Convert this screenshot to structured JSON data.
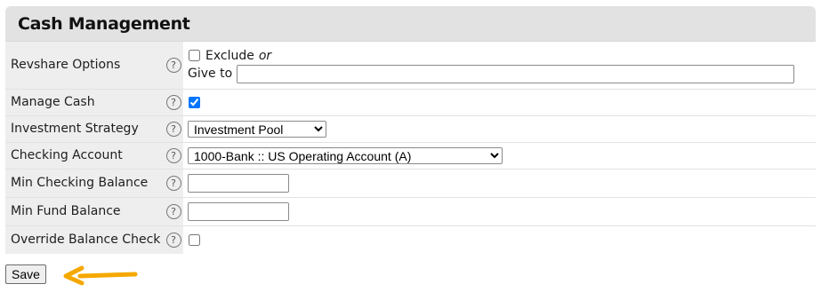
{
  "panel": {
    "title": "Cash Management"
  },
  "help_glyph": "?",
  "rows": {
    "revshare": {
      "label": "Revshare Options",
      "exclude_label": "Exclude",
      "or_text": "or",
      "give_to_label": "Give to",
      "exclude_checked": false,
      "give_to_value": ""
    },
    "manage_cash": {
      "label": "Manage Cash",
      "checked": true
    },
    "investment_strategy": {
      "label": "Investment Strategy",
      "selected": "Investment Pool"
    },
    "checking_account": {
      "label": "Checking Account",
      "selected": "1000-Bank :: US Operating Account (A)"
    },
    "min_checking_balance": {
      "label": "Min Checking Balance",
      "value": ""
    },
    "min_fund_balance": {
      "label": "Min Fund Balance",
      "value": ""
    },
    "override_balance_check": {
      "label": "Override Balance Check",
      "checked": false
    }
  },
  "actions": {
    "save_label": "Save"
  },
  "colors": {
    "arrow": "#f5a800",
    "header_bg": "#e2e2e2",
    "label_bg": "#eeeeee"
  }
}
